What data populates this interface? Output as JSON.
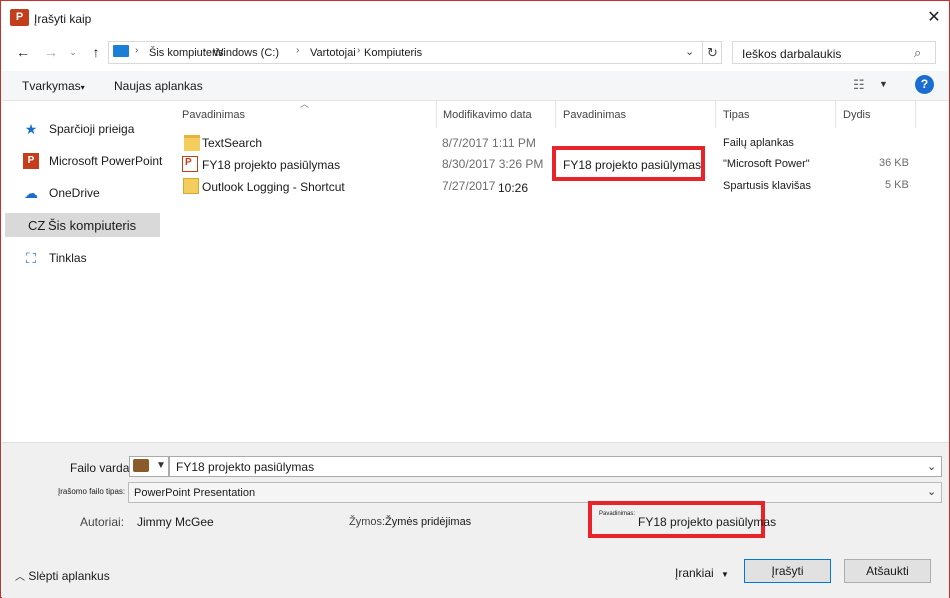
{
  "window": {
    "title": "Įrašyti kaip",
    "app_icon": "P"
  },
  "address": {
    "crumbs": [
      "Šis kompiuteris",
      "Windows (C:)",
      "Vartotojai",
      "Kompiuteris"
    ],
    "search_placeholder": "Ieškos darbalaukis"
  },
  "toolbar": {
    "organize_label": "Tvarkymas",
    "new_folder_label": "Naujas aplankas",
    "help_label": "?"
  },
  "sidebar": {
    "items": [
      {
        "label": "Sparčioji prieiga",
        "icon": "star-icon"
      },
      {
        "label": "Microsoft PowerPoint",
        "icon": "powerpoint-icon"
      },
      {
        "label": "OneDrive",
        "icon": "cloud-icon"
      },
      {
        "label": "Šis kompiuteris",
        "prefix": "CZ",
        "icon": "computer-icon",
        "selected": true
      },
      {
        "label": "Tinklas",
        "icon": "network-icon"
      }
    ]
  },
  "columns": [
    "Pavadinimas",
    "Modifikavimo data",
    "Pavadinimas",
    "Tipas",
    "Dydis"
  ],
  "files": [
    {
      "name": "TextSearch",
      "date": "8/7/2017 1:11 PM",
      "title": "",
      "type": "Failų aplankas",
      "size": "",
      "icon": "folder-icon"
    },
    {
      "name": "FY18 projekto pasiūlymas",
      "date": "8/30/2017 3:26 PM",
      "title": "FY18 projekto pasiūlymas",
      "type": "\"Microsoft Power\"",
      "size": "36 KB",
      "icon": "powerpoint-file-icon"
    },
    {
      "name": "Outlook Logging - Shortcut",
      "date": "7/27/2017",
      "time": "10:26",
      "title": "",
      "type": "Spartusis klavišas",
      "size": "5 KB",
      "icon": "shortcut-icon"
    }
  ],
  "form": {
    "filename_label": "Failo vardas:",
    "filename_value": "FY18 projekto pasiūlymas",
    "filetype_label": "Įrašomo failo tipas:",
    "filetype_value": "PowerPoint Presentation",
    "authors_label": "Autoriai:",
    "authors_value": "Jimmy McGee",
    "tags_label": "Žymos:",
    "tags_value": "Žymės pridėjimas",
    "title_label": "Pavadinimas:",
    "title_value": "FY18 projekto pasiūlymas"
  },
  "footer": {
    "hide_folders_label": "Slėpti aplankus",
    "tools_label": "Įrankiai",
    "save_label": "Įrašyti",
    "cancel_label": "Atšaukti"
  },
  "colors": {
    "accent": "#0078d7",
    "highlight": "#e8242a",
    "window_border": "#c8302c",
    "ppt": "#c43e1c"
  }
}
